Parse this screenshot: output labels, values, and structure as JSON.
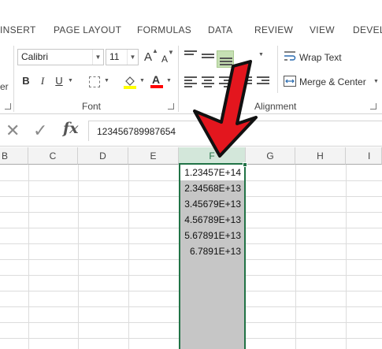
{
  "ribbon_tabs": [
    "INSERT",
    "PAGE LAYOUT",
    "FORMULAS",
    "DATA",
    "REVIEW",
    "VIEW",
    "DEVELO"
  ],
  "font_group": {
    "label": "Font",
    "font_name": "Calibri",
    "font_size": "11",
    "bold": "B",
    "italic": "I",
    "underline": "U",
    "grow": "A",
    "shrink": "A"
  },
  "alignment_group": {
    "label": "Alignment",
    "wrap_text": "Wrap Text",
    "merge_center": "Merge & Center"
  },
  "formula_bar": {
    "cancel": "✕",
    "enter": "✓",
    "fx": "fx",
    "value": "123456789987654"
  },
  "columns": [
    "B",
    "C",
    "D",
    "E",
    "F",
    "G",
    "H",
    "I"
  ],
  "selected_column": "F",
  "column_f_values": [
    "1.23457E+14",
    "2.34568E+13",
    "3.45679E+13",
    "4.56789E+13",
    "5.67891E+13",
    "6.7891E+13"
  ],
  "colors": {
    "accent_green": "#217346",
    "arrow_red": "#e3161e",
    "selection_gray": "#c6c6c6",
    "fill_color_bar": "#ffff00",
    "font_color_bar": "#ff0000"
  }
}
